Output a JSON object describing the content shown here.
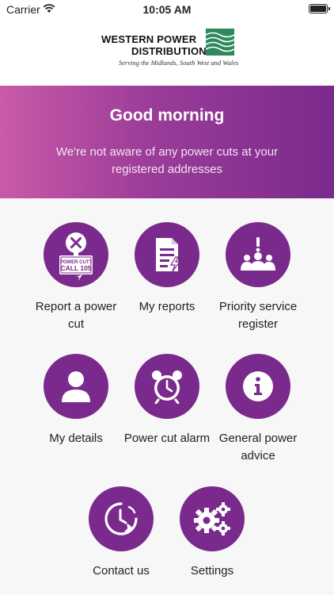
{
  "status_bar": {
    "carrier": "Carrier",
    "time": "10:05 AM"
  },
  "logo": {
    "line1": "WESTERN POWER",
    "line2": "DISTRIBUTION",
    "tagline": "Serving the Midlands, South West and Wales"
  },
  "banner": {
    "greeting": "Good morning",
    "message": "We're not aware of any power cuts at your registered addresses"
  },
  "tiles": [
    {
      "label": "Report a power cut",
      "icon": "report-power-cut-icon",
      "sign_line1": "POWER CUT?",
      "sign_line2": "CALL 105"
    },
    {
      "label": "My reports",
      "icon": "document-icon"
    },
    {
      "label": "Priority service register",
      "icon": "priority-group-icon"
    },
    {
      "label": "My details",
      "icon": "person-icon"
    },
    {
      "label": "Power cut alarm",
      "icon": "alarm-clock-icon"
    },
    {
      "label": "General power advice",
      "icon": "info-icon"
    },
    {
      "label": "Contact us",
      "icon": "phone-clock-icon"
    },
    {
      "label": "Settings",
      "icon": "gears-icon"
    }
  ],
  "colors": {
    "brand_purple": "#7a2a8c",
    "banner_start": "#c95aa8",
    "banner_end": "#7a2a8c"
  }
}
